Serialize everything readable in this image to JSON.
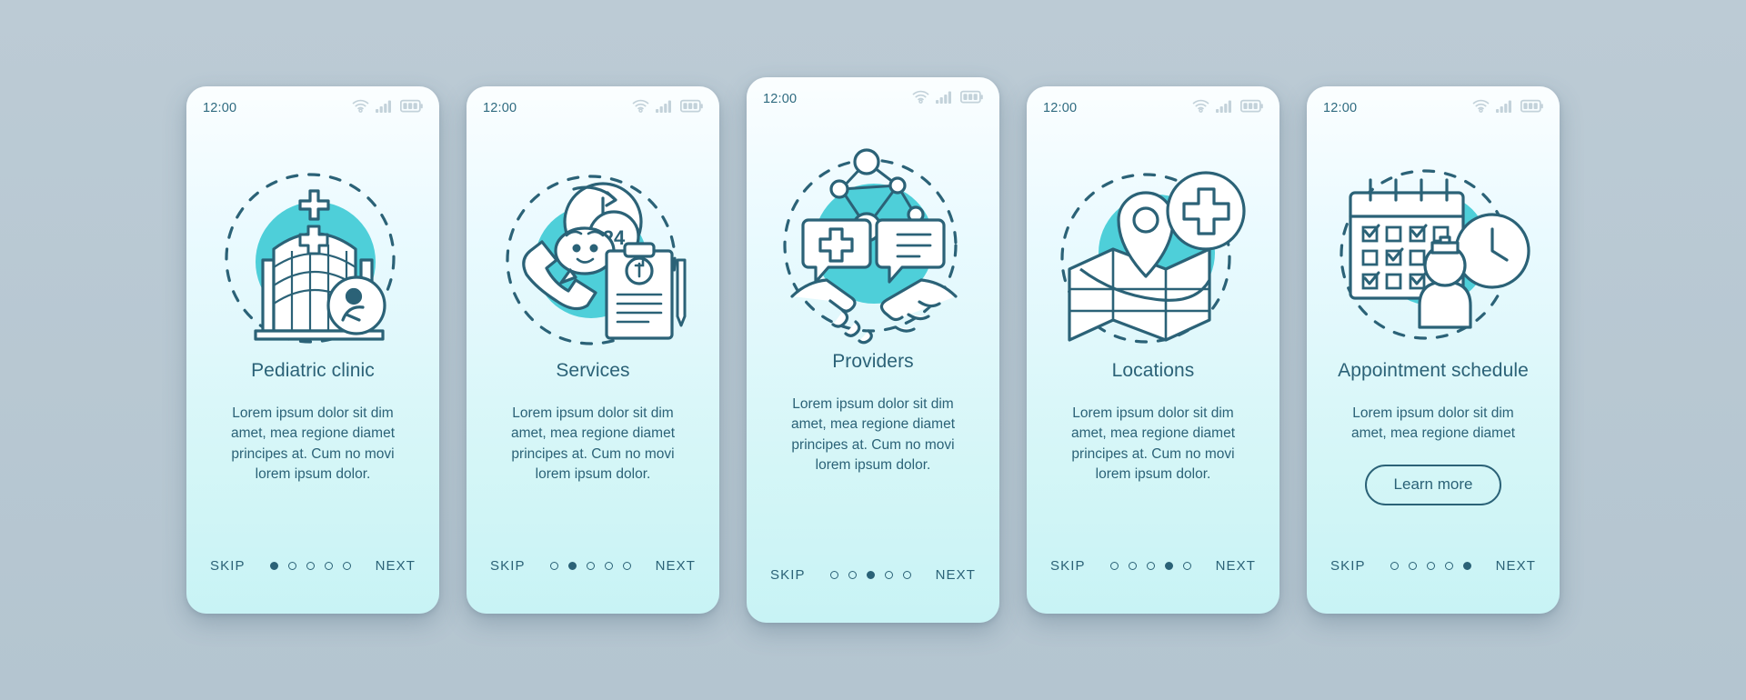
{
  "theme": {
    "background": "#b9c9d4",
    "card_top": "#fbfeff",
    "card_bottom": "#c8f3f5",
    "accent_teal": "#4ecfd9",
    "ink": "#2b6277",
    "status_gray": "#c3d2da"
  },
  "icons": {
    "wifi": "wifi-icon",
    "signal": "signal-bars-icon",
    "battery": "battery-icon"
  },
  "screens": [
    {
      "id": "pediatric-clinic",
      "clock": "12:00",
      "illustration": "hospital-building-icon",
      "title": "Pediatric clinic",
      "description": "Lorem ipsum dolor sit dim amet, mea regione diamet principes at. Cum no movi lorem ipsum dolor.",
      "skip_label": "SKIP",
      "next_label": "NEXT",
      "dots_total": 5,
      "dots_active": 1,
      "has_button": false,
      "button_label": ""
    },
    {
      "id": "services",
      "clock": "12:00",
      "illustration": "phone-24h-clipboard-icon",
      "title": "Services",
      "description": "Lorem ipsum dolor sit dim amet, mea regione diamet principes at. Cum no movi lorem ipsum dolor.",
      "skip_label": "SKIP",
      "next_label": "NEXT",
      "dots_total": 5,
      "dots_active": 2,
      "has_button": false,
      "button_label": ""
    },
    {
      "id": "providers",
      "clock": "12:00",
      "illustration": "handshake-network-icon",
      "title": "Providers",
      "description": "Lorem ipsum dolor sit dim amet, mea regione diamet principes at. Cum no movi lorem ipsum dolor.",
      "skip_label": "SKIP",
      "next_label": "NEXT",
      "dots_total": 5,
      "dots_active": 3,
      "has_button": false,
      "button_label": ""
    },
    {
      "id": "locations",
      "clock": "12:00",
      "illustration": "map-pin-cross-icon",
      "title": "Locations",
      "description": "Lorem ipsum dolor sit dim amet, mea regione diamet principes at. Cum no movi lorem ipsum dolor.",
      "skip_label": "SKIP",
      "next_label": "NEXT",
      "dots_total": 5,
      "dots_active": 4,
      "has_button": false,
      "button_label": ""
    },
    {
      "id": "appointment-schedule",
      "clock": "12:00",
      "illustration": "calendar-clock-doctor-icon",
      "title": "Appointment schedule",
      "description": "Lorem ipsum dolor sit dim amet, mea regione diamet",
      "skip_label": "SKIP",
      "next_label": "NEXT",
      "dots_total": 5,
      "dots_active": 5,
      "has_button": true,
      "button_label": "Learn more"
    }
  ]
}
